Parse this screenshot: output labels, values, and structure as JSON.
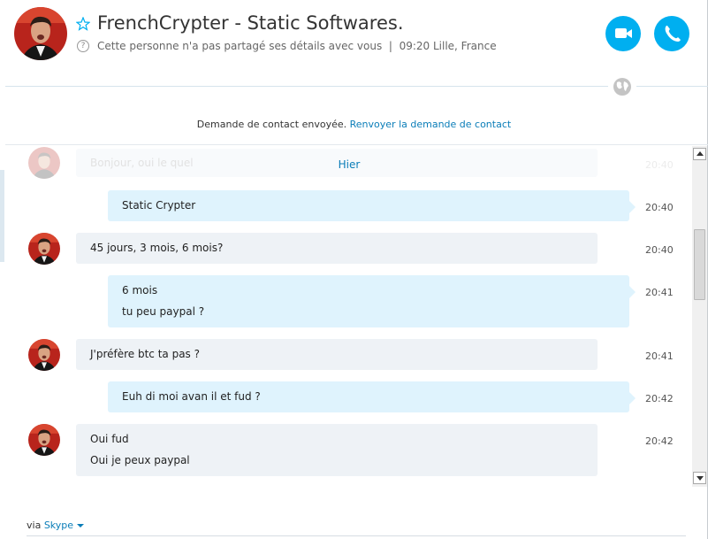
{
  "header": {
    "contact_name": "FrenchCrypter - Static Softwares.",
    "status_text": "Cette personne n'a pas partagé ses détails avec vous",
    "status_separator": "|",
    "local_time": "09:20 Lille, France"
  },
  "request_bar": {
    "text": "Demande de contact envoyée.",
    "link": "Renvoyer la demande de contact"
  },
  "conversation": {
    "day_label": "Hier",
    "ghost_message": {
      "text": "Bonjour, oui le quel",
      "time": "20:40"
    },
    "messages": [
      {
        "direction": "outgoing",
        "lines": [
          "Static Crypter"
        ],
        "time": "20:40"
      },
      {
        "direction": "incoming",
        "lines": [
          "45 jours, 3 mois, 6 mois?"
        ],
        "time": "20:40"
      },
      {
        "direction": "outgoing",
        "lines": [
          "6 mois",
          "tu peu paypal ?"
        ],
        "time": "20:41"
      },
      {
        "direction": "incoming",
        "lines": [
          "J'préfère btc ta pas ?"
        ],
        "time": "20:41"
      },
      {
        "direction": "outgoing",
        "lines": [
          "Euh di moi avan il et fud ?"
        ],
        "time": "20:42"
      },
      {
        "direction": "incoming",
        "lines": [
          "Oui fud",
          "Oui je peux paypal"
        ],
        "time": "20:42"
      }
    ]
  },
  "footer": {
    "via_label": "via",
    "service": "Skype"
  },
  "colors": {
    "accent": "#00aff0",
    "link": "#0a7db8",
    "outgoing_bubble": "#dff3fd",
    "incoming_bubble": "#eef2f6"
  },
  "icons": [
    "star-icon",
    "help-icon",
    "video-camera-icon",
    "phone-icon",
    "globe-icon",
    "caret-down-icon"
  ]
}
